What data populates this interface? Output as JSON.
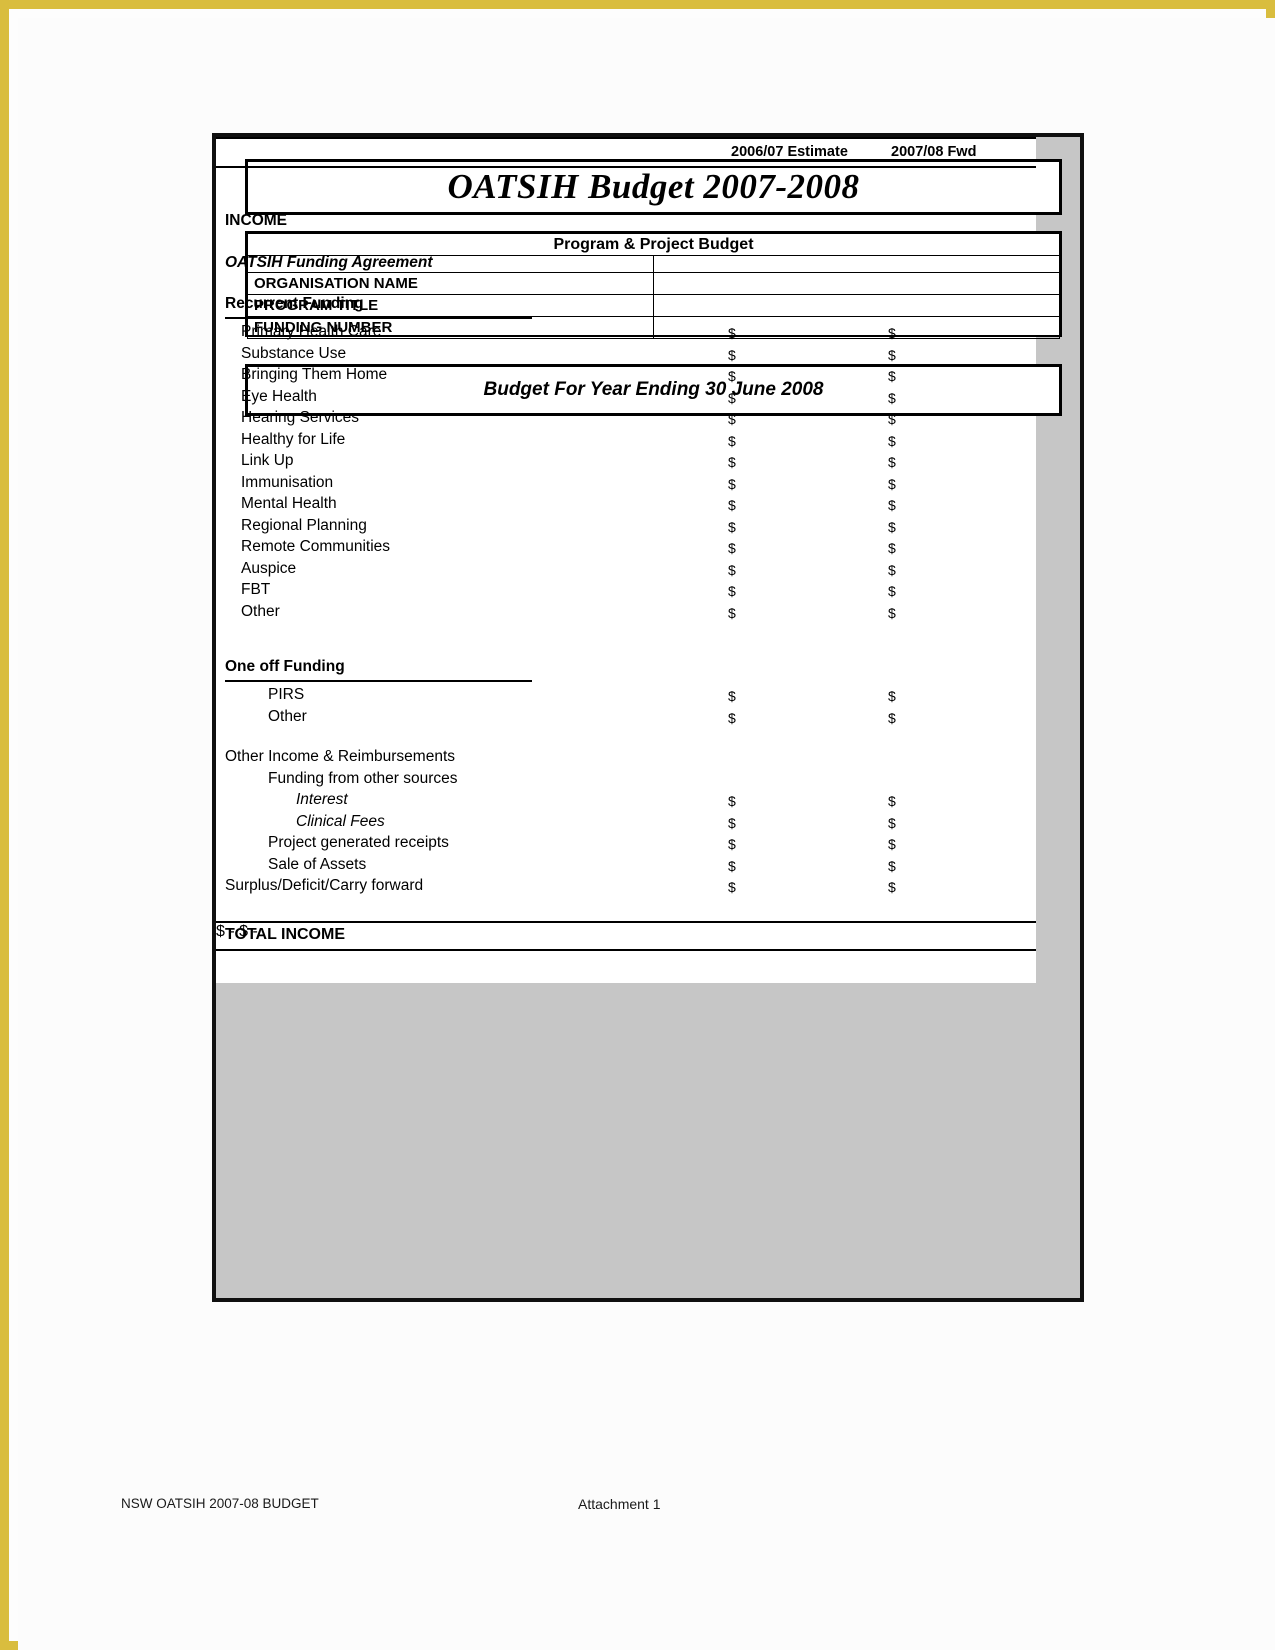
{
  "document": {
    "title": "OATSIH Budget 2007-2008",
    "subtitle": "Program & Project Budget",
    "year_heading": "Budget For Year Ending 30 June 2008"
  },
  "org_table": {
    "header": "Program & Project Budget",
    "rows": [
      {
        "label": "",
        "value": ""
      },
      {
        "label": "ORGANISATION NAME",
        "value": ""
      },
      {
        "label": "PROGRAM TITLE",
        "value": ""
      },
      {
        "label": "FUNDING NUMBER",
        "value": ""
      }
    ]
  },
  "budget": {
    "columns": [
      "2006/07 Estimate",
      "2007/08 Fwd"
    ],
    "section_title": "INCOME",
    "agreement_title": "OATSIH Funding Agreement",
    "recurrent_group": "Recurrent Funding",
    "recurrent_items": [
      {
        "label": "Primary Health Care",
        "est": "$",
        "fwd": "$"
      },
      {
        "label": "Substance Use",
        "est": "$",
        "fwd": "$"
      },
      {
        "label": "Bringing Them Home",
        "est": "$",
        "fwd": "$"
      },
      {
        "label": "Eye Health",
        "est": "$",
        "fwd": "$"
      },
      {
        "label": "Hearing Services",
        "est": "$",
        "fwd": "$"
      },
      {
        "label": "Healthy for Life",
        "est": "$",
        "fwd": "$"
      },
      {
        "label": "Link Up",
        "est": "$",
        "fwd": "$"
      },
      {
        "label": "Immunisation",
        "est": "$",
        "fwd": "$"
      },
      {
        "label": "Mental Health",
        "est": "$",
        "fwd": "$"
      },
      {
        "label": "Regional Planning",
        "est": "$",
        "fwd": "$"
      },
      {
        "label": "Remote Communities",
        "est": "$",
        "fwd": "$"
      },
      {
        "label": "Auspice",
        "est": "$",
        "fwd": "$"
      },
      {
        "label": "FBT",
        "est": "$",
        "fwd": "$"
      },
      {
        "label": "Other",
        "est": "$",
        "fwd": "$"
      }
    ],
    "oneoff_group": "One off Funding",
    "oneoff_items": [
      {
        "label": "PIRS",
        "est": "$",
        "fwd": "$"
      },
      {
        "label": "Other",
        "est": "$",
        "fwd": "$"
      }
    ],
    "other_income_heading": "Other Income & Reimbursements",
    "other_sources_heading": "Funding from other sources",
    "other_items": [
      {
        "label": "Interest",
        "est": "$",
        "fwd": "$"
      },
      {
        "label": "Clinical Fees",
        "est": "$",
        "fwd": "$"
      },
      {
        "label": "Project generated receipts",
        "est": "$",
        "fwd": "$"
      },
      {
        "label": "Sale of Assets",
        "est": "$",
        "fwd": "$"
      }
    ],
    "surplus": {
      "label": "Surplus/Deficit/Carry forward",
      "est": "$",
      "fwd": "$"
    },
    "total": {
      "label": "TOTAL INCOME",
      "est": "$",
      "est_dash": "-",
      "fwd": "$",
      "fwd_dash": "-"
    }
  },
  "footer": {
    "left": "NSW OATSIH 2007-08 BUDGET",
    "center": "Attachment 1",
    "watermark": ""
  },
  "colors": {
    "page_border": "#d9bd3e",
    "panel_fill": "#c6c6c6",
    "rule": "#000000"
  }
}
